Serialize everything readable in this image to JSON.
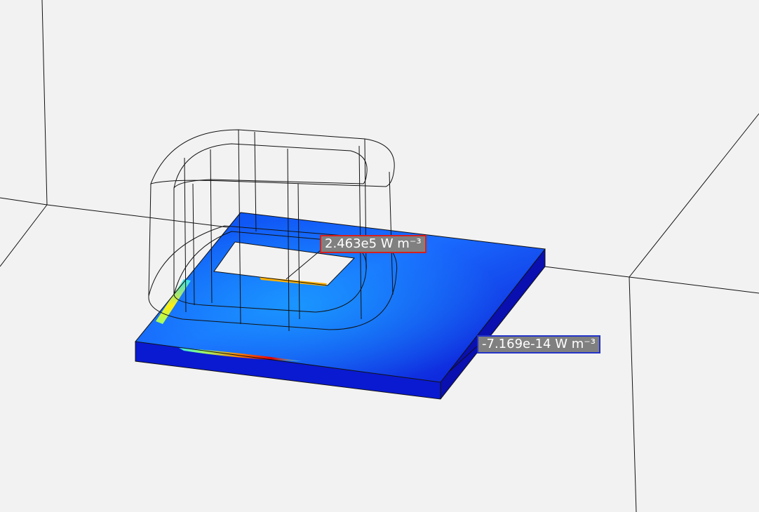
{
  "viewport": {
    "background": "#f2f2f2",
    "colormap": [
      "#0a10c8",
      "#0a4cf0",
      "#1aa0ff",
      "#32e0f0",
      "#9bff6a",
      "#ffee10",
      "#ff7a00",
      "#e80000",
      "#900000"
    ]
  },
  "annotations": {
    "max_label": "2.463e5 W m⁻³",
    "max_border": "#d42020",
    "min_label": "-7.169e-14 W m⁻³",
    "min_border": "#2333c7"
  }
}
